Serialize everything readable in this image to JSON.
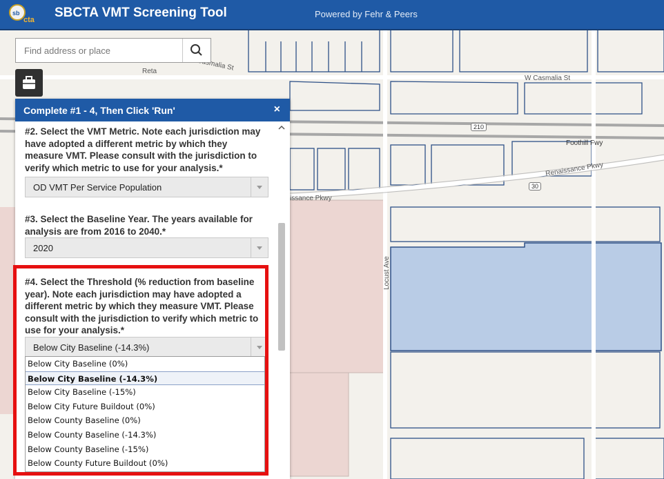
{
  "header": {
    "logo_text": "sbcta",
    "title": "SBCTA VMT Screening Tool",
    "powered_by": "Powered by Fehr & Peers",
    "bar_color": "#1f5aa6"
  },
  "search": {
    "placeholder": "Find address or place",
    "icon": "search-icon"
  },
  "tool_button": {
    "icon": "briefcase-icon"
  },
  "panel": {
    "title": "Complete #1 - 4, Then Click 'Run'",
    "close_label": "×",
    "q2": {
      "text": "#2. Select the VMT Metric. Note each jurisdiction may have adopted a different metric by which they measure VMT. Please consult with the jurisdiction to verify which metric to use for your analysis.*",
      "value": "OD VMT Per Service Population"
    },
    "q3": {
      "text": "#3. Select the Baseline Year. The years available for analysis are from 2016 to 2040.*",
      "value": "2020"
    },
    "q4": {
      "text": "#4. Select the Threshold (% reduction from baseline year). Note each jurisdiction may have adopted a different metric by which they measure VMT. Please consult with the jurisdiction to verify which metric to use for your analysis.*",
      "value": "Below City Baseline (-14.3%)"
    }
  },
  "dropdown": {
    "options": [
      "Below City Baseline (0%)",
      "Below City Baseline (-14.3%)",
      "Below City Baseline (-15%)",
      "Below City Future Buildout (0%)",
      "Below County Baseline (0%)",
      "Below County Baseline (-14.3%)",
      "Below County Baseline (-15%)",
      "Below County Future Buildout (0%)"
    ],
    "selected_index": 1
  },
  "map": {
    "labels": {
      "casmalia": "Casmalia St",
      "w_casmalia": "W Casmalia St",
      "foothill": "Foothill Fwy",
      "renaissance": "Renaissance Pkwy",
      "renaissance_left": "issance Pkwy",
      "locust": "Locust Ave",
      "reta": "Reta",
      "shield_210": "210",
      "shield_30": "30"
    },
    "highlight_color": "#b9cce6",
    "highlight_border": "#2c4f86"
  }
}
